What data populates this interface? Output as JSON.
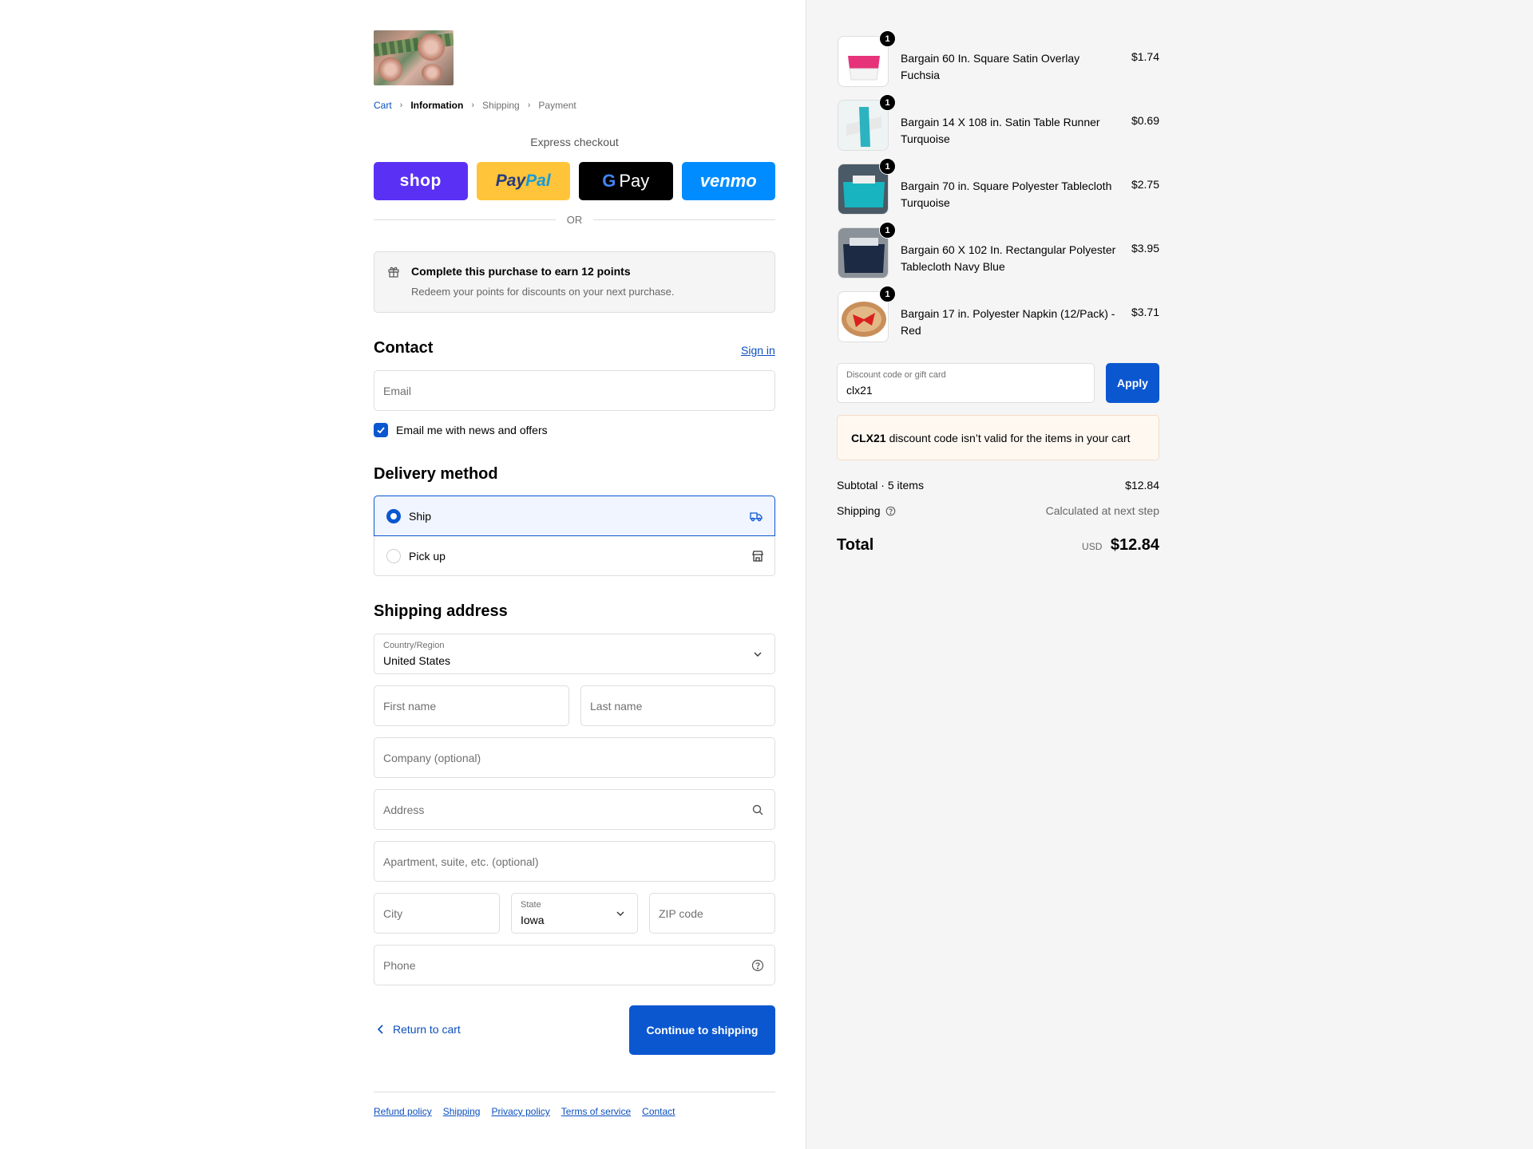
{
  "breadcrumb": {
    "cart": "Cart",
    "information": "Information",
    "shipping": "Shipping",
    "payment": "Payment"
  },
  "express": {
    "title": "Express checkout",
    "shop": "shop",
    "paypal_a": "Pay",
    "paypal_b": "Pal",
    "gpay_g": "G",
    "gpay_pay": "Pay",
    "venmo": "venmo",
    "or": "OR"
  },
  "points": {
    "title": "Complete this purchase to earn 12 points",
    "subtitle": "Redeem your points for discounts on your next purchase."
  },
  "contact": {
    "heading": "Contact",
    "signin": "Sign in",
    "email_placeholder": "Email",
    "news_label": "Email me with news and offers",
    "news_checked": true
  },
  "delivery": {
    "heading": "Delivery method",
    "ship": "Ship",
    "pickup": "Pick up",
    "selected": "ship"
  },
  "shipping_address": {
    "heading": "Shipping address",
    "country_label": "Country/Region",
    "country_value": "United States",
    "first_name": "First name",
    "last_name": "Last name",
    "company": "Company (optional)",
    "address": "Address",
    "apartment": "Apartment, suite, etc. (optional)",
    "city": "City",
    "state_label": "State",
    "state_value": "Iowa",
    "zip": "ZIP code",
    "phone": "Phone"
  },
  "actions": {
    "return": "Return to cart",
    "continue": "Continue to shipping"
  },
  "footer_links": [
    "Refund policy",
    "Shipping",
    "Privacy policy",
    "Terms of service",
    "Contact"
  ],
  "cart_items": [
    {
      "name": "Bargain 60 In. Square Satin Overlay Fuchsia",
      "price": "$1.74",
      "qty": "1",
      "color": "#e6337a"
    },
    {
      "name": "Bargain 14 X 108 in. Satin Table Runner Turquoise",
      "price": "$0.69",
      "qty": "1",
      "color": "#2cb3bf"
    },
    {
      "name": "Bargain 70 in. Square Polyester Tablecloth Turquoise",
      "price": "$2.75",
      "qty": "1",
      "color": "#18b5c0"
    },
    {
      "name": "Bargain 60 X 102 In. Rectangular Polyester Tablecloth Navy Blue",
      "price": "$3.95",
      "qty": "1",
      "color": "#1d2a44"
    },
    {
      "name": "Bargain 17 in. Polyester Napkin (12/Pack) - Red",
      "price": "$3.71",
      "qty": "1",
      "color": "#d9211f"
    }
  ],
  "discount": {
    "label": "Discount code or gift card",
    "value": "clx21",
    "apply": "Apply",
    "error_code": "CLX21",
    "error_msg": "discount code isn’t valid for the items in your cart"
  },
  "summary": {
    "subtotal_label": "Subtotal · 5 items",
    "subtotal_value": "$12.84",
    "shipping_label": "Shipping",
    "shipping_value": "Calculated at next step",
    "total_label": "Total",
    "currency": "USD",
    "total_value": "$12.84"
  },
  "colors": {
    "primary": "#0b57d0",
    "link": "#0b4fbf",
    "shop": "#5a31f4",
    "paypal": "#ffc439",
    "venmo": "#008cff"
  }
}
